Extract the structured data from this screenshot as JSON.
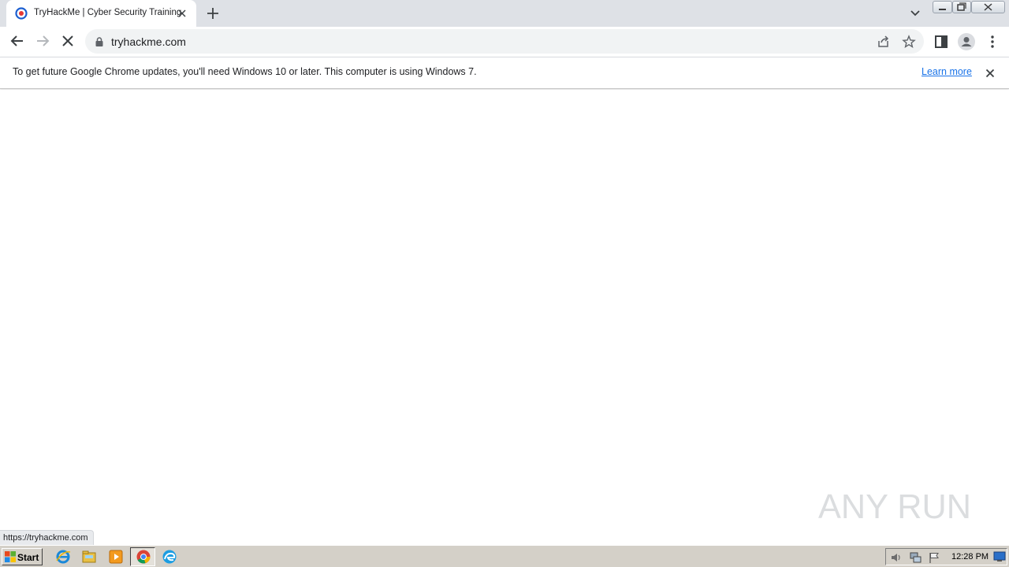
{
  "browser": {
    "tab": {
      "title": "TryHackMe | Cyber Security Training",
      "favicon": "tryhackme-favicon-icon"
    },
    "omnibox": {
      "url": "tryhackme.com"
    },
    "infobar": {
      "message": "To get future Google Chrome updates, you'll need Windows 10 or later. This computer is using Windows 7.",
      "link": "Learn more"
    },
    "status_url": "https://tryhackme.com"
  },
  "watermark": {
    "text": "ANY RUN"
  },
  "taskbar": {
    "start_label": "Start",
    "clock": "12:28 PM",
    "apps": [
      "internet-explorer-icon",
      "file-explorer-icon",
      "media-player-icon",
      "chrome-icon",
      "edge-icon"
    ]
  },
  "colors": {
    "accent": "#1a73e8",
    "tabstrip": "#dee1e6",
    "taskbar": "#d4d0c8"
  }
}
